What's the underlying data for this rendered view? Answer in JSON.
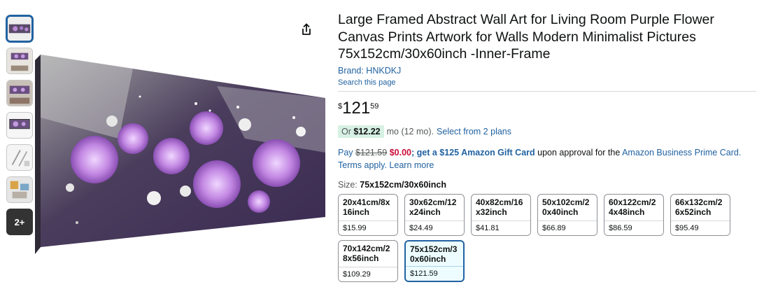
{
  "gallery": {
    "more_label": "2+"
  },
  "product": {
    "title": "Large Framed Abstract Wall Art for Living Room Purple Flower Canvas Prints Artwork for Walls Modern Minimalist Pictures 75x152cm/30x60inch -Inner-Frame",
    "brand": "Brand: HNKDKJ",
    "search_link": "Search this page"
  },
  "price": {
    "symbol": "$",
    "whole": "121",
    "fraction": "59"
  },
  "monthly": {
    "lead": "Or",
    "amount": "$12.22",
    "term": "mo (12 mo).",
    "plans_link": "Select from 2 plans"
  },
  "promo": {
    "pay": "Pay",
    "old_price": "$121.59",
    "new_price": "$0.00",
    "get": "; get a",
    "gift": "$125 Amazon Gift Card",
    "upon": "upon approval for the",
    "card": "Amazon Business Prime Card.",
    "terms": "Terms apply.",
    "learn": "Learn more"
  },
  "size": {
    "label": "Size:",
    "selected": "75x152cm/30x60inch",
    "options": [
      {
        "name": "20x41cm/8x16inch",
        "price": "$15.99"
      },
      {
        "name": "30x62cm/12x24inch",
        "price": "$24.49"
      },
      {
        "name": "40x82cm/16x32inch",
        "price": "$41.81"
      },
      {
        "name": "50x102cm/20x40inch",
        "price": "$66.89"
      },
      {
        "name": "60x122cm/24x48inch",
        "price": "$86.59"
      },
      {
        "name": "66x132cm/26x52inch",
        "price": "$95.49"
      },
      {
        "name": "70x142cm/28x56inch",
        "price": "$109.29"
      },
      {
        "name": "75x152cm/30x60inch",
        "price": "$121.59"
      }
    ]
  },
  "colors": {
    "link": "#2162a1",
    "accent_red": "#cc0c39",
    "pill_bg": "#d7f0e4",
    "selected_border": "#2162a1"
  },
  "icons": {
    "share": "share-icon"
  }
}
